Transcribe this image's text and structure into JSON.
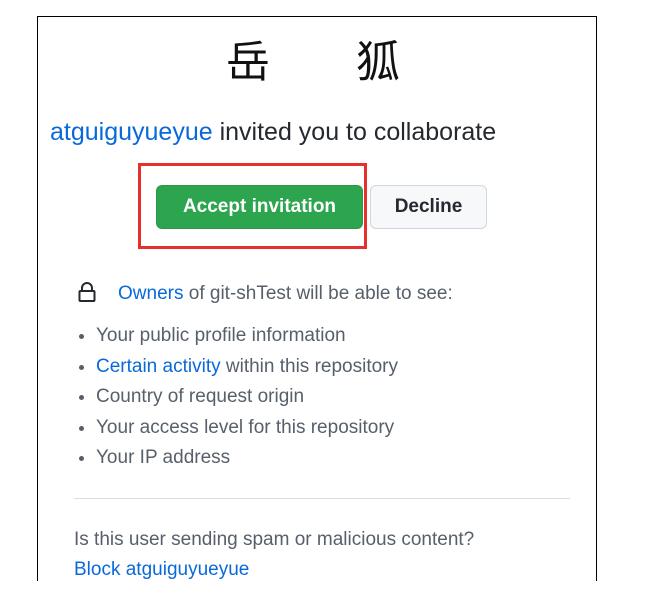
{
  "header": {
    "glyph_left": "岳",
    "glyph_right": "狐"
  },
  "invite": {
    "inviter": "atguiguyueyue",
    "message": " invited you to collaborate"
  },
  "actions": {
    "accept_label": "Accept invitation",
    "decline_label": "Decline"
  },
  "permissions": {
    "owners_link": "Owners",
    "intro_rest": " of git-shTest will be able to see:",
    "items": [
      {
        "text": "Your public profile information"
      },
      {
        "link": "Certain activity",
        "text": " within this repository"
      },
      {
        "text": "Country of request origin"
      },
      {
        "text": "Your access level for this repository"
      },
      {
        "text": "Your IP address"
      }
    ]
  },
  "footer": {
    "spam_question": "Is this user sending spam or malicious content?",
    "block_label": "Block atguiguyueyue"
  },
  "colors": {
    "accept": "#2da44e",
    "link": "#0969da",
    "highlight": "#e5302b"
  },
  "icons": {
    "permissions": "lock-icon"
  }
}
